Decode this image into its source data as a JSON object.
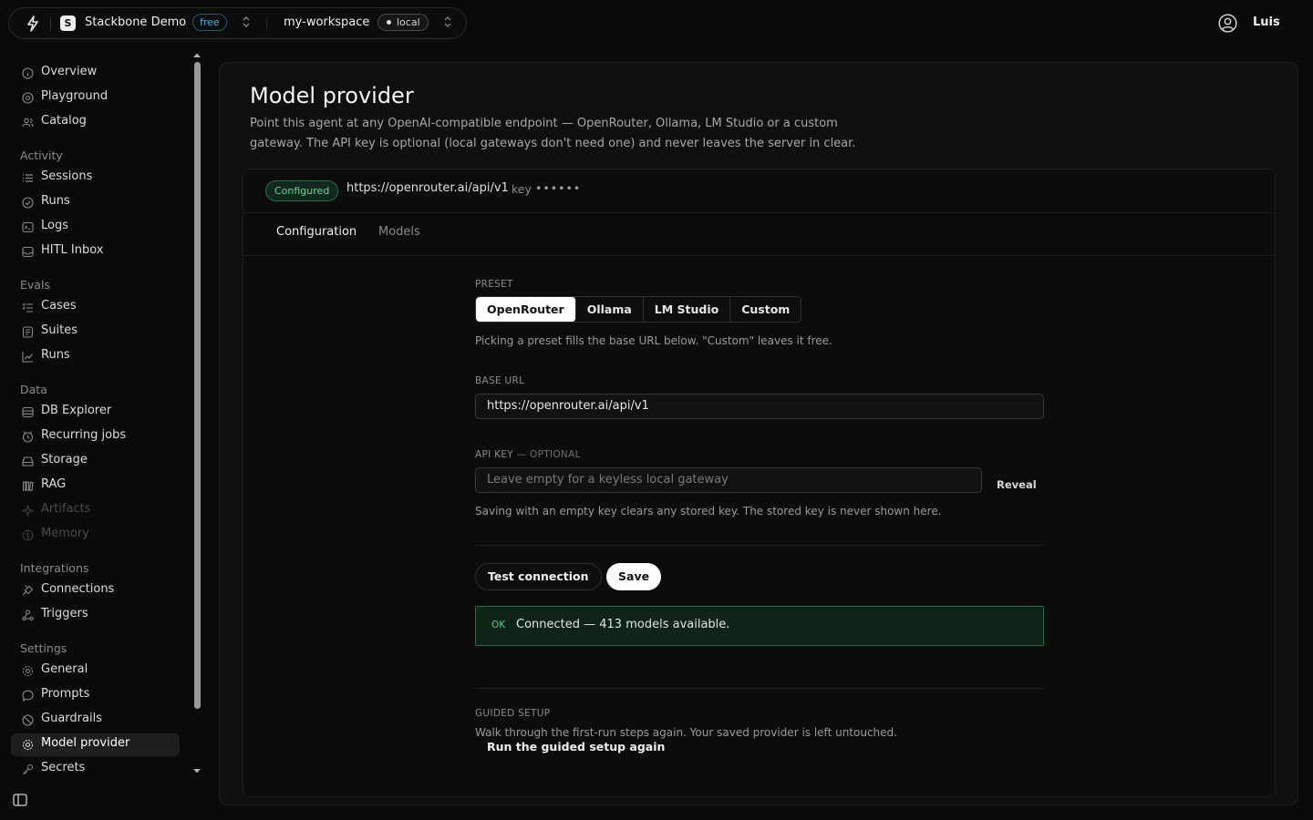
{
  "topbar": {
    "org_initial": "S",
    "org_name": "Stackbone Demo",
    "plan": "free",
    "workspace": "my-workspace",
    "env": "local",
    "user": "Luis"
  },
  "sidebar": {
    "top_items": [
      {
        "label": "Overview",
        "icon": "info-icon"
      },
      {
        "label": "Playground",
        "icon": "target-icon"
      },
      {
        "label": "Catalog",
        "icon": "users-icon"
      }
    ],
    "groups": [
      {
        "label": "Activity",
        "items": [
          {
            "label": "Sessions",
            "icon": "list-icon"
          },
          {
            "label": "Runs",
            "icon": "check-circle-icon"
          },
          {
            "label": "Logs",
            "icon": "terminal-icon"
          },
          {
            "label": "HITL Inbox",
            "icon": "inbox-icon"
          }
        ]
      },
      {
        "label": "Evals",
        "items": [
          {
            "label": "Cases",
            "icon": "checklist-icon"
          },
          {
            "label": "Suites",
            "icon": "layers-icon"
          },
          {
            "label": "Runs",
            "icon": "chart-line-icon"
          }
        ]
      },
      {
        "label": "Data",
        "items": [
          {
            "label": "DB Explorer",
            "icon": "database-icon"
          },
          {
            "label": "Recurring jobs",
            "icon": "clock-icon"
          },
          {
            "label": "Storage",
            "icon": "hard-drive-icon"
          },
          {
            "label": "RAG",
            "icon": "books-icon"
          },
          {
            "label": "Artifacts",
            "icon": "sparkle-icon",
            "disabled": true
          },
          {
            "label": "Memory",
            "icon": "brain-icon",
            "disabled": true
          }
        ]
      },
      {
        "label": "Integrations",
        "items": [
          {
            "label": "Connections",
            "icon": "plug-icon"
          },
          {
            "label": "Triggers",
            "icon": "webhook-icon"
          }
        ]
      },
      {
        "label": "Settings",
        "items": [
          {
            "label": "General",
            "icon": "gear-icon"
          },
          {
            "label": "Prompts",
            "icon": "message-icon"
          },
          {
            "label": "Guardrails",
            "icon": "shield-off-icon"
          },
          {
            "label": "Model provider",
            "icon": "chip-icon",
            "active": true
          },
          {
            "label": "Secrets",
            "icon": "key-icon"
          }
        ]
      }
    ]
  },
  "page": {
    "title": "Model provider",
    "description": "Point this agent at any OpenAI-compatible endpoint — OpenRouter, Ollama, LM Studio or a custom gateway. The API key is optional (local gateways don't need one) and never leaves the server in clear."
  },
  "status": {
    "badge": "Configured",
    "url": "https://openrouter.ai/api/v1",
    "key_label": "key",
    "key_masked": "••••••"
  },
  "tabs": [
    {
      "label": "Configuration",
      "active": true
    },
    {
      "label": "Models",
      "active": false
    }
  ],
  "form": {
    "preset_label": "PRESET",
    "presets": [
      "OpenRouter",
      "Ollama",
      "LM Studio",
      "Custom"
    ],
    "preset_selected": "OpenRouter",
    "preset_help": "Picking a preset fills the base URL below. \"Custom\" leaves it free.",
    "base_url_label": "BASE URL",
    "base_url_value": "https://openrouter.ai/api/v1",
    "api_key_label": "API KEY",
    "api_key_optional": " — OPTIONAL",
    "api_key_placeholder": "Leave empty for a keyless local gateway",
    "reveal_label": "Reveal",
    "api_key_help": "Saving with an empty key clears any stored key. The stored key is never shown here.",
    "test_button": "Test connection",
    "save_button": "Save",
    "result_tag": "OK",
    "result_message": "Connected — 413 models available.",
    "guided_label": "GUIDED SETUP",
    "guided_help": "Walk through the first-run steps again. Your saved provider is left untouched.",
    "guided_button": "Run the guided setup again"
  },
  "colors": {
    "accent_green": "#5bc98a",
    "plan_badge": "#3fb0d6",
    "background": "#0a0a0a"
  }
}
